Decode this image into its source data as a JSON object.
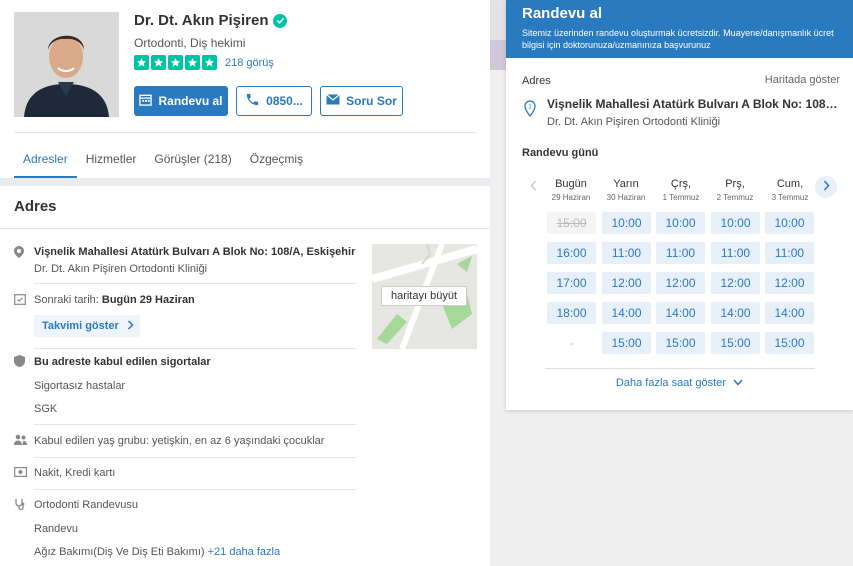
{
  "doctor": {
    "name": "Dr. Dt. Akın Pişiren",
    "specialty": "Ortodonti, Diş hekimi",
    "rating_stars": 5,
    "rating_count": "218 görüş",
    "buttons": {
      "appointment": "Randevu al",
      "phone": "0850...",
      "ask": "Soru Sor"
    }
  },
  "tabs": [
    {
      "label": "Adresler",
      "active": true
    },
    {
      "label": "Hizmetler",
      "active": false
    },
    {
      "label": "Görüşler (218)",
      "active": false
    },
    {
      "label": "Özgeçmiş",
      "active": false
    }
  ],
  "address_section": {
    "title": "Adres",
    "street": "Vişnelik Mahallesi Atatürk Bulvarı A Blok No: 108/A, Eskişehir",
    "clinic": "Dr. Dt. Akın Pişiren Ortodonti Kliniği",
    "map_button": "haritayı büyüt",
    "next_date_label": "Sonraki tarih:",
    "next_date_value": "Bugün 29 Haziran",
    "calendar_button": "Takvimi göster",
    "insurance_title": "Bu adreste kabul edilen sigortalar",
    "insurance_items": [
      "Sigortasız hastalar",
      "SGK"
    ],
    "age_group": "Kabul edilen yaş grubu: yetişkin, en az 6 yaşındaki çocuklar",
    "payment": "Nakit, Kredi kartı",
    "services": [
      "Ortodonti Randevusu",
      "Randevu",
      "Ağız Bakımı(Diş Ve Diş Eti Bakımı)"
    ],
    "services_more": "+21 daha fazla"
  },
  "booking": {
    "title": "Randevu al",
    "subtitle": "Sitemiz üzerinden randevu oluşturmak ücretsizdir. Muayene/danışmanlık ücret bilgisi için doktorunuza/uzmanınıza başvurunuz",
    "address_label": "Adres",
    "map_link": "Haritada göster",
    "address_line": "Vişnelik Mahallesi Atatürk Bulvarı A Blok No: 108/A, ...",
    "clinic": "Dr. Dt. Akın Pişiren Ortodonti Kliniği",
    "day_label": "Randevu günü",
    "show_more": "Daha fazla saat göster",
    "days": [
      {
        "name": "Bugün",
        "date": "29 Haziran",
        "slots": [
          "15:00",
          "16:00",
          "17:00",
          "18:00",
          "-"
        ]
      },
      {
        "name": "Yarın",
        "date": "30 Haziran",
        "slots": [
          "10:00",
          "11:00",
          "12:00",
          "14:00",
          "15:00"
        ]
      },
      {
        "name": "Çrş,",
        "date": "1 Temmuz",
        "slots": [
          "10:00",
          "11:00",
          "12:00",
          "14:00",
          "15:00"
        ]
      },
      {
        "name": "Prş,",
        "date": "2 Temmuz",
        "slots": [
          "10:00",
          "11:00",
          "12:00",
          "14:00",
          "15:00"
        ]
      },
      {
        "name": "Cum,",
        "date": "3 Temmuz",
        "slots": [
          "10:00",
          "11:00",
          "12:00",
          "14:00",
          "15:00"
        ]
      }
    ]
  },
  "colors": {
    "accent": "#2a7ac0",
    "star": "#00c3a5",
    "slot_bg": "#e7eff8"
  }
}
